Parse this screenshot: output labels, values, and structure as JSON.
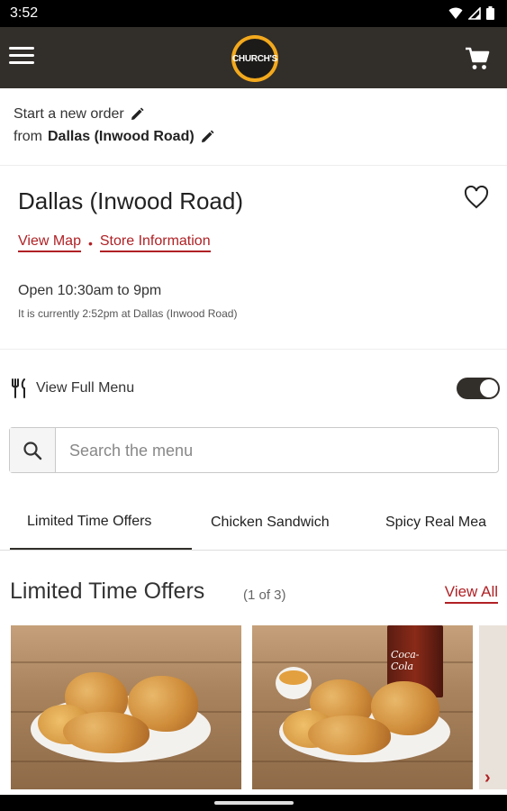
{
  "status_bar": {
    "time": "3:52"
  },
  "app_bar": {
    "logo_text": "CHURCH'S"
  },
  "order": {
    "start_text": "Start a new order",
    "from_text": "from",
    "location": "Dallas (Inwood Road)"
  },
  "store": {
    "name": "Dallas (Inwood Road)",
    "view_map": "View Map",
    "separator": "•",
    "store_info": "Store Information",
    "hours": "Open 10:30am to 9pm",
    "current_time": "It is currently 2:52pm at Dallas (Inwood Road)"
  },
  "menu": {
    "full_menu_label": "View Full Menu",
    "full_menu_enabled": true
  },
  "search": {
    "placeholder": "Search the menu"
  },
  "tabs": [
    {
      "label": "Limited Time Offers",
      "active": true
    },
    {
      "label": "Chicken Sandwich",
      "active": false
    },
    {
      "label": "Spicy Real Mea",
      "active": false
    }
  ],
  "section": {
    "title": "Limited Time Offers",
    "count": "(1 of 3)",
    "view_all": "View All"
  },
  "products": [
    {
      "image": "fried-chicken-plate"
    },
    {
      "image": "fried-chicken-with-drink"
    }
  ],
  "colors": {
    "app_bar": "#322e2a",
    "accent": "#b02125",
    "logo_ring": "#f3a91d"
  }
}
